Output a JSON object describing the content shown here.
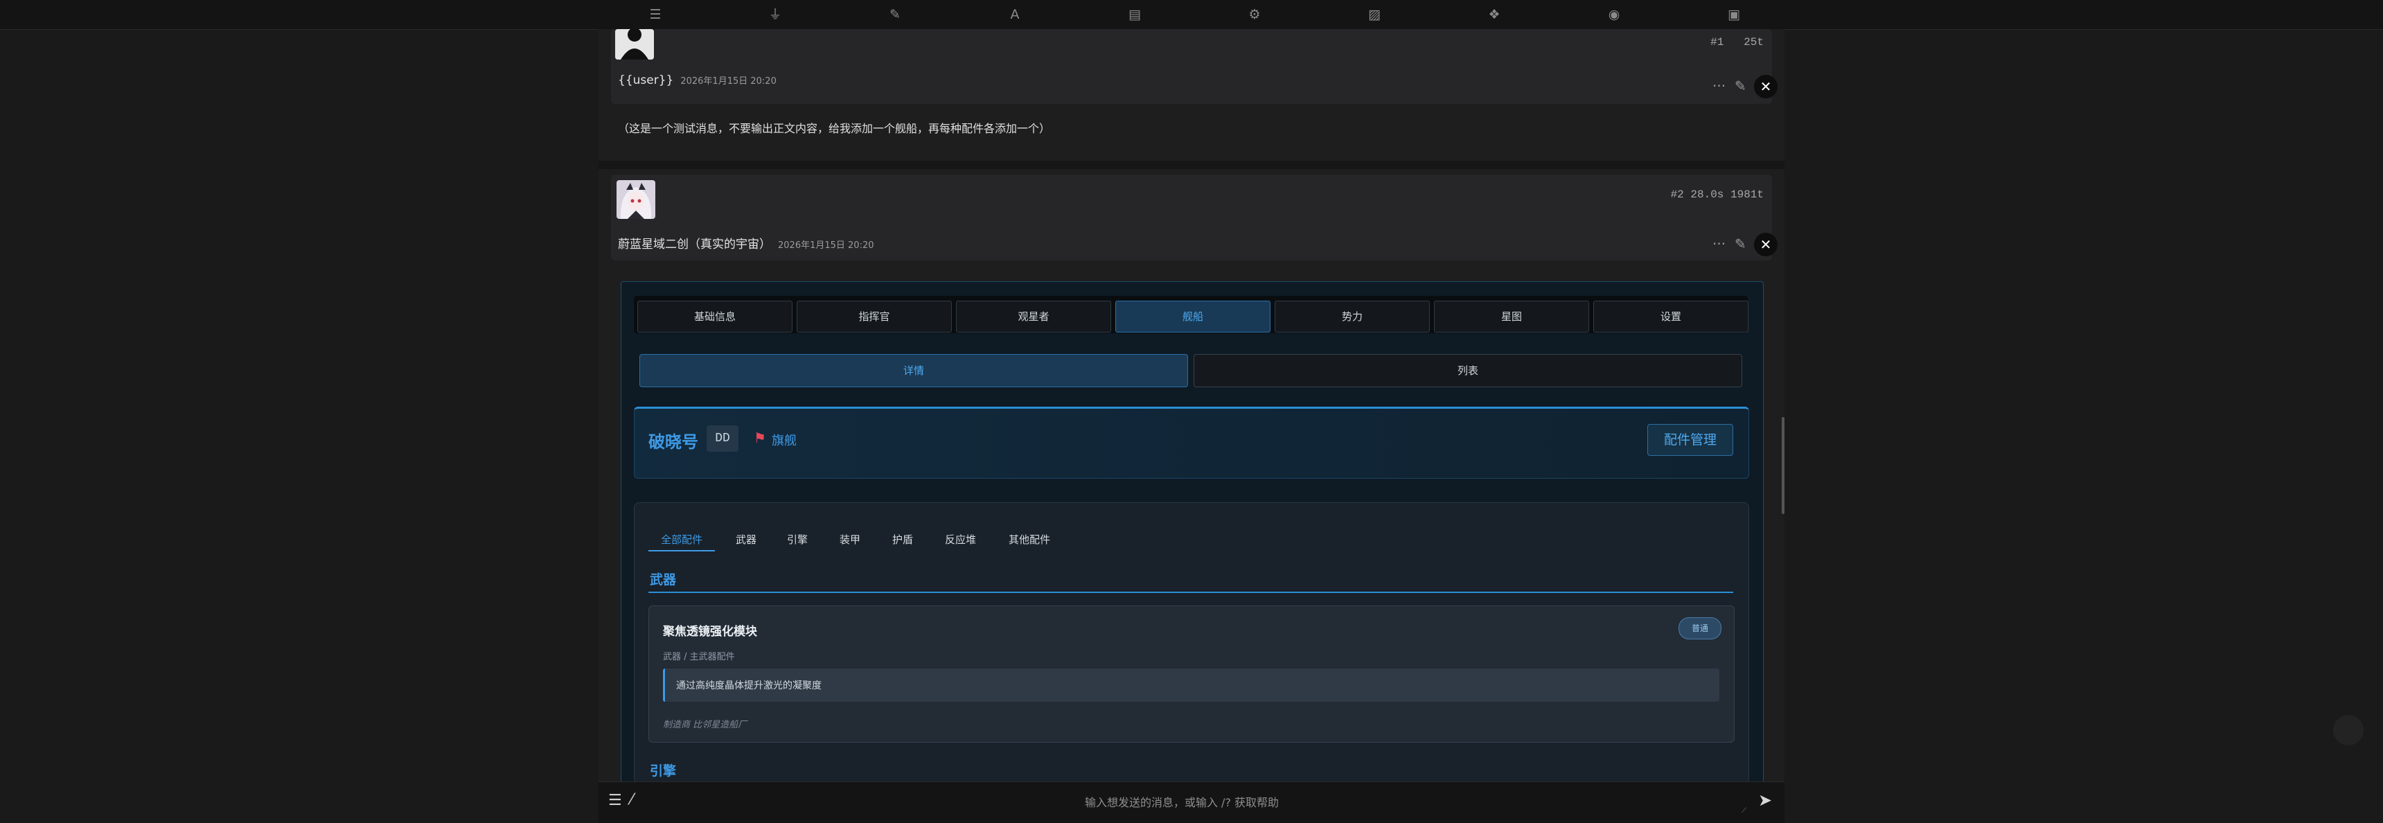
{
  "toolbar": {
    "icons": [
      "sliders-icon",
      "plug-icon",
      "pencil-icon",
      "font-icon",
      "book-icon",
      "user-gear-icon",
      "image-icon",
      "cubes-icon",
      "globe-icon",
      "id-card-icon"
    ]
  },
  "message1": {
    "index": "#1",
    "tokens": "25t",
    "user": "{{user}}",
    "date": "2026年1月15日 20:20",
    "body": "（这是一个测试消息，不要输出正文内容，给我添加一个舰船，再每种配件各添加一个）"
  },
  "message2": {
    "meta": "#2  28.0s  1981t",
    "name": "蔚蓝星域二创（真实的宇宙）",
    "date": "2026年1月15日 20:20"
  },
  "app": {
    "tabs": [
      "基础信息",
      "指挥官",
      "观星者",
      "舰船",
      "势力",
      "星图",
      "设置"
    ],
    "active_tab": "舰船",
    "subtabs": [
      "详情",
      "列表"
    ],
    "ship": {
      "name": "破晓号",
      "class": "DD",
      "flag_label": "旗舰",
      "manage_button": "配件管理"
    },
    "part_tabs": [
      "全部配件",
      "武器",
      "引擎",
      "装甲",
      "护盾",
      "反应堆",
      "其他配件"
    ],
    "section_weapon": "武器",
    "item": {
      "name": "聚焦透镜强化模块",
      "badge": "普通",
      "category": "武器 / 主武器配件",
      "desc": "通过高纯度晶体提升激光的凝聚度",
      "maker": "制造商 比邻星造船厂"
    },
    "section_engine": "引擎"
  },
  "input": {
    "placeholder": "输入想发送的消息，或输入 /? 获取帮助"
  },
  "colors": {
    "accent": "#3e9ae6",
    "background": "#1a1a1b",
    "flag": "#e8475a"
  }
}
